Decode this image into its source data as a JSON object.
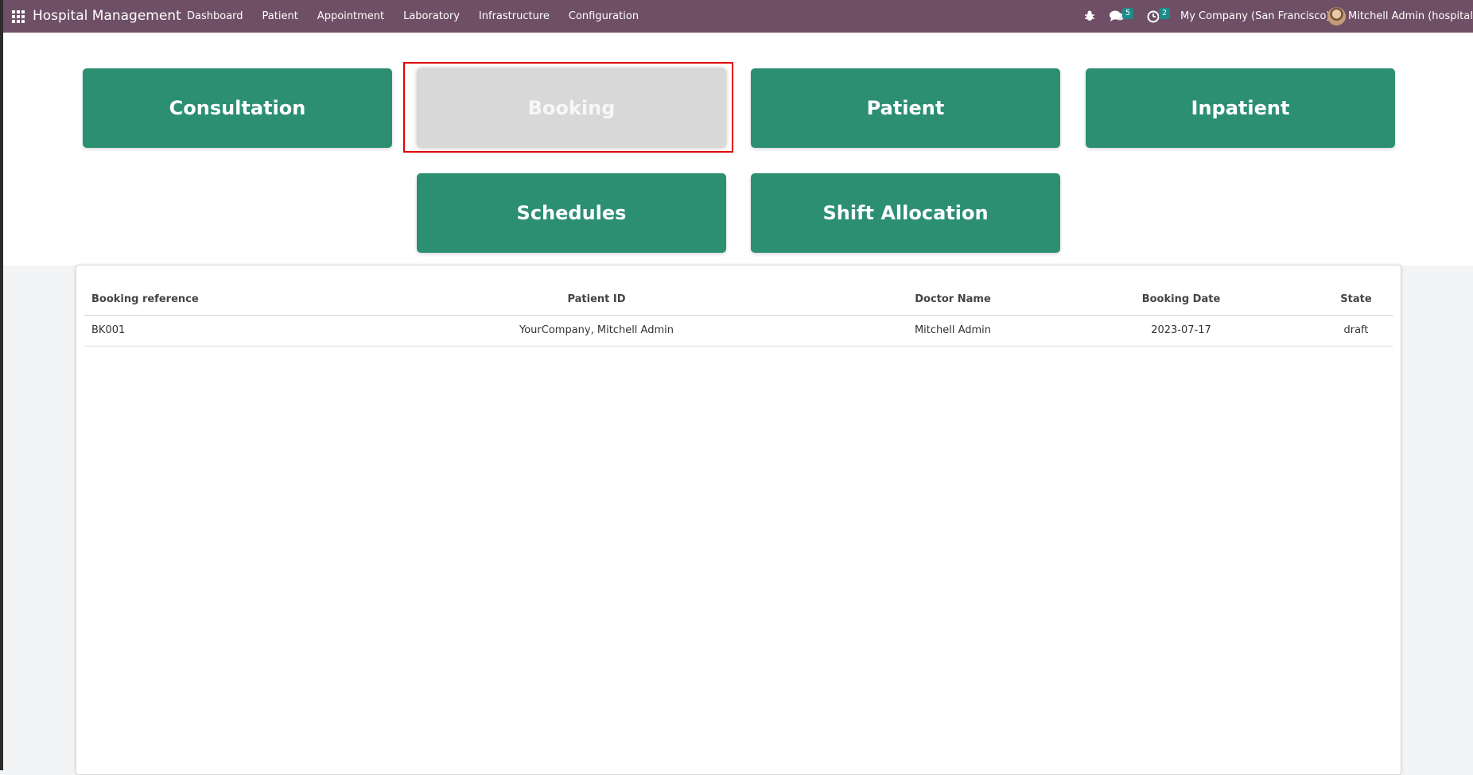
{
  "navbar": {
    "brand": "Hospital Management",
    "menu": [
      "Dashboard",
      "Patient",
      "Appointment",
      "Laboratory",
      "Infrastructure",
      "Configuration"
    ],
    "messages_count": "5",
    "activities_count": "2",
    "company": "My Company (San Francisco)",
    "user": "Mitchell Admin (hospital)",
    "icons": [
      "apps-grid-icon",
      "bug-icon",
      "chat-icon",
      "clock-icon",
      "avatar"
    ]
  },
  "tiles": {
    "consultation": "Consultation",
    "booking": "Booking",
    "patient": "Patient",
    "inpatient": "Inpatient",
    "schedules": "Schedules",
    "shift_allocation": "Shift Allocation",
    "active": "Booking"
  },
  "table": {
    "headers": [
      "Booking reference",
      "Patient ID",
      "Doctor Name",
      "Booking Date",
      "State"
    ],
    "rows": [
      [
        "BK001",
        "YourCompany, Mitchell Admin",
        "Mitchell Admin",
        "2023-07-17",
        "draft"
      ]
    ]
  },
  "colors": {
    "navbar": "#6e4f65",
    "tile": "#2c8f72",
    "tile_active": "#d8d8d8",
    "badge": "#1c8b89",
    "highlight": "#e00000"
  }
}
